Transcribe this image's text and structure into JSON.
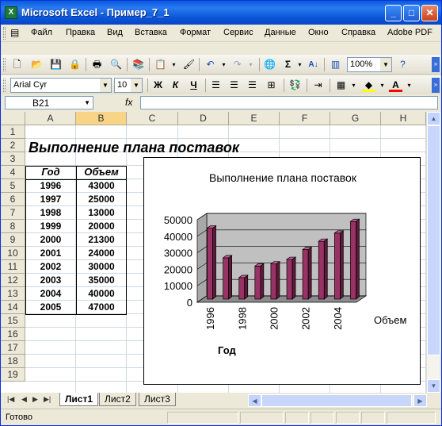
{
  "window": {
    "title": "Microsoft Excel - Пример_7_1",
    "app_icon": "X"
  },
  "menu": [
    "Файл",
    "Правка",
    "Вид",
    "Вставка",
    "Формат",
    "Сервис",
    "Данные",
    "Окно",
    "Справка",
    "Adobe PDF"
  ],
  "toolbar": {
    "zoom": "100%",
    "font_name": "Arial Cyr",
    "font_size": "10",
    "bold": "Ж",
    "italic": "К",
    "underline": "Ч"
  },
  "formula_bar": {
    "name_box": "B21",
    "fx": "fx",
    "content": ""
  },
  "columns": [
    "A",
    "B",
    "C",
    "D",
    "E",
    "F",
    "G",
    "H"
  ],
  "rows": [
    "1",
    "2",
    "3",
    "4",
    "5",
    "6",
    "7",
    "8",
    "9",
    "10",
    "11",
    "12",
    "13",
    "14",
    "15",
    "16",
    "17",
    "18",
    "19"
  ],
  "sheet": {
    "title": "Выполнение плана поставок",
    "table_headers": [
      "Год",
      "Объем"
    ],
    "table_rows": [
      [
        "1996",
        "43000"
      ],
      [
        "1997",
        "25000"
      ],
      [
        "1998",
        "13000"
      ],
      [
        "1999",
        "20000"
      ],
      [
        "2000",
        "21300"
      ],
      [
        "2001",
        "24000"
      ],
      [
        "2002",
        "30000"
      ],
      [
        "2003",
        "35000"
      ],
      [
        "2004",
        "40000"
      ],
      [
        "2005",
        "47000"
      ]
    ]
  },
  "chart_data": {
    "type": "bar",
    "title": "Выполнение плана поставок",
    "xlabel": "Год",
    "series_label": "Объем",
    "categories": [
      "1996",
      "1997",
      "1998",
      "1999",
      "2000",
      "2001",
      "2002",
      "2003",
      "2004",
      "2005"
    ],
    "x_tick_labels": [
      "1996",
      "1998",
      "2000",
      "2002",
      "2004"
    ],
    "y_ticks": [
      "0",
      "10000",
      "20000",
      "30000",
      "40000",
      "50000"
    ],
    "series": [
      {
        "name": "Объем",
        "values": [
          43000,
          25000,
          13000,
          20000,
          21300,
          24000,
          30000,
          35000,
          40000,
          47000
        ],
        "color": "#993366"
      }
    ],
    "ylim": [
      0,
      50000
    ],
    "grid": true,
    "three_d": true
  },
  "sheet_tabs": [
    "Лист1",
    "Лист2",
    "Лист3"
  ],
  "status": "Готово"
}
